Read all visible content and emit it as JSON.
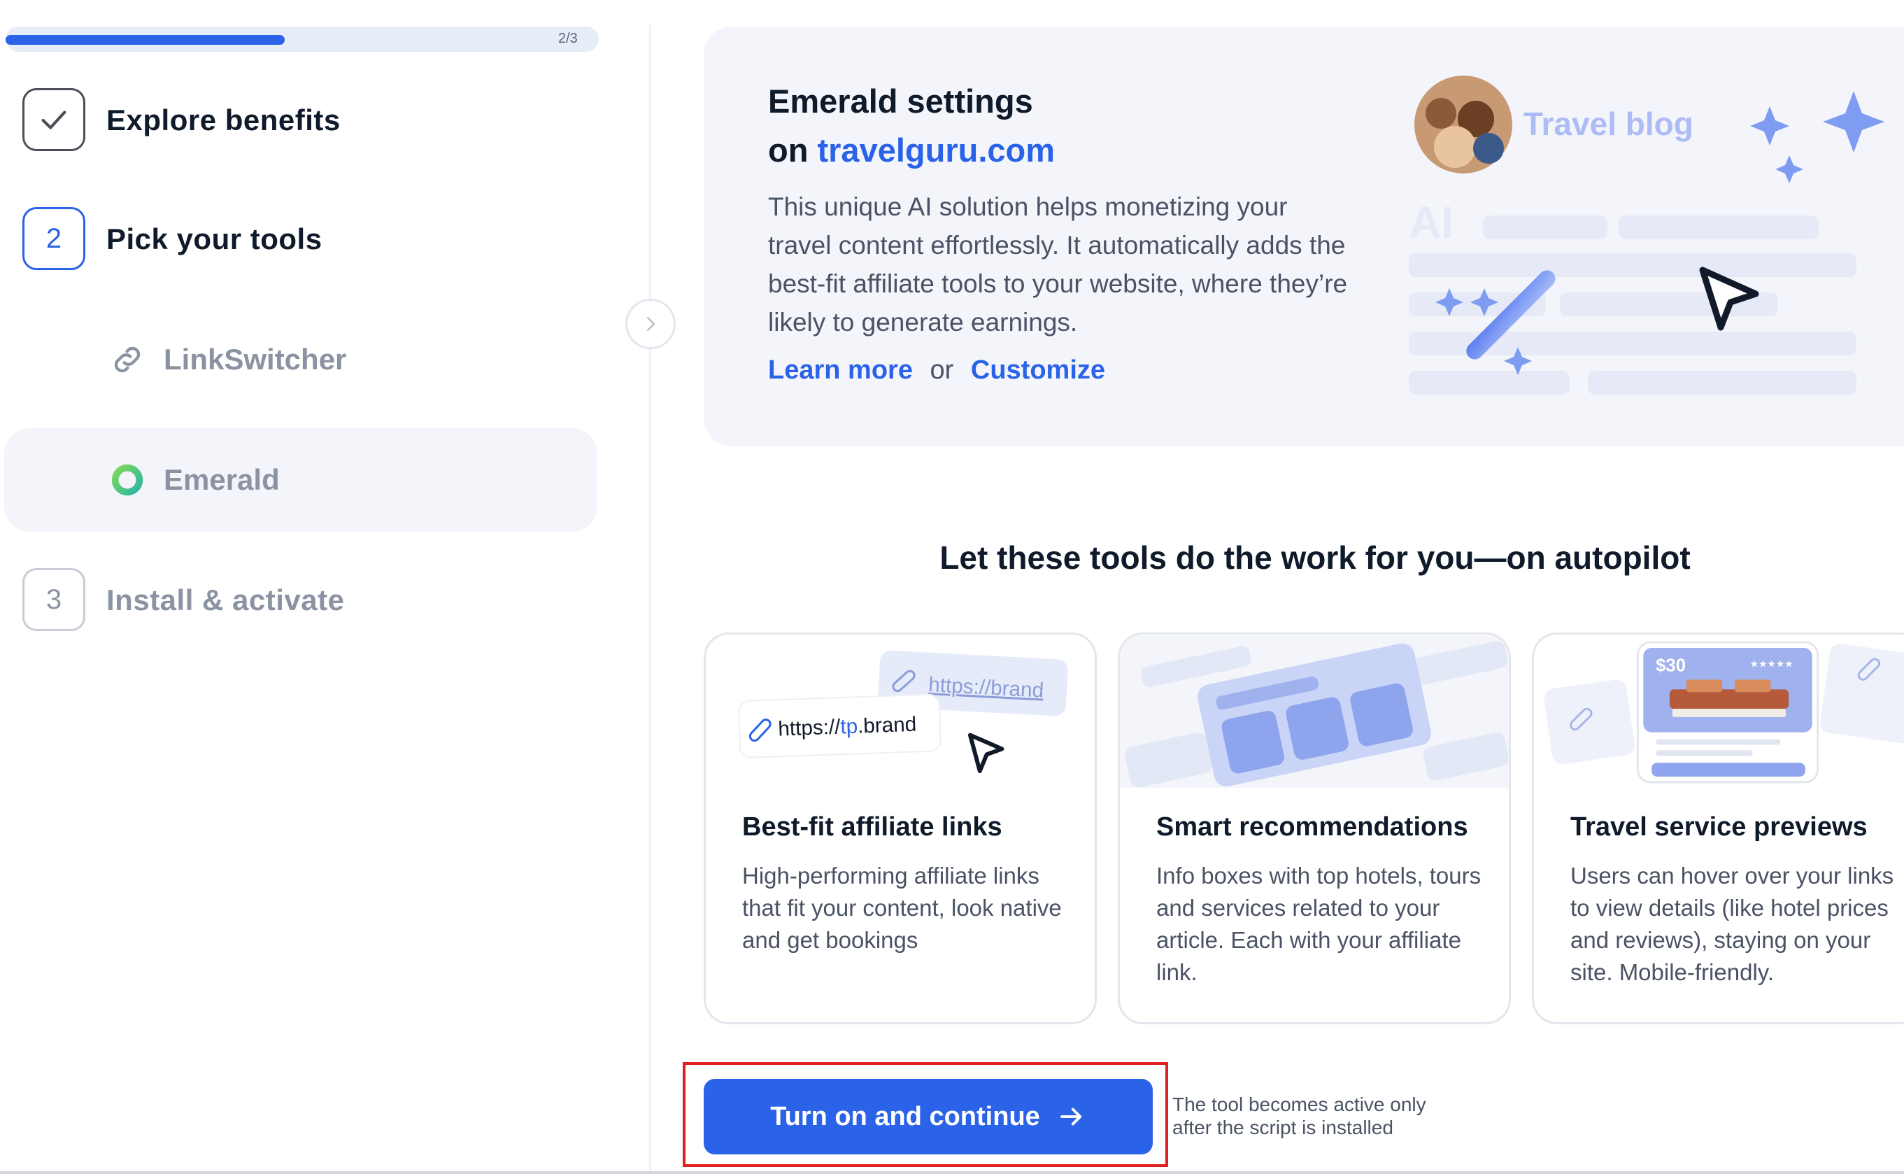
{
  "progress": {
    "count": "2/3",
    "fraction": 0.47
  },
  "steps": [
    {
      "number": "",
      "label": "Explore benefits",
      "state": "done"
    },
    {
      "number": "2",
      "label": "Pick your tools",
      "state": "active"
    },
    {
      "number": "3",
      "label": "Install & activate",
      "state": "pending"
    }
  ],
  "subitems": [
    {
      "label": "LinkSwitcher",
      "icon": "link-icon"
    },
    {
      "label": "Emerald",
      "icon": "emerald-ring-icon",
      "selected": true
    }
  ],
  "card": {
    "title_line1": "Emerald settings",
    "title_on": "on",
    "domain": "travelguru.com",
    "description": "This unique AI solution helps monetizing your travel content effortlessly. It automatically adds the best-fit affiliate tools to your website, where they’re likely to generate earnings.",
    "learn_more": "Learn more",
    "or": "or",
    "customize": "Customize",
    "illustration": {
      "blog_label": "Travel blog",
      "ai_label": "AI"
    }
  },
  "tools": {
    "heading": "Let these tools do the work for you—on autopilot",
    "items": [
      {
        "title": "Best-fit affiliate links",
        "description": "High-performing affiliate links that fit your content, look native and get bookings",
        "url_back": "https://brand",
        "url_front_prefix": "https://",
        "url_front_highlight": "tp",
        "url_front_suffix": ".brand"
      },
      {
        "title": "Smart recommendations",
        "description": "Info boxes with top hotels, tours and services related to your article. Each with your affiliate link."
      },
      {
        "title": "Travel service previews",
        "description": "Users can hover over your links to view details (like hotel prices and reviews), staying on your site. Mobile-friendly.",
        "price": "$30",
        "stars": "★★★★★"
      }
    ]
  },
  "footer": {
    "button_label": "Turn on and continue",
    "note": "The tool becomes active only after the script is installed"
  },
  "colors": {
    "accent": "#2a62e8",
    "highlight": "#e02020",
    "panel": "#f3f5fb"
  }
}
